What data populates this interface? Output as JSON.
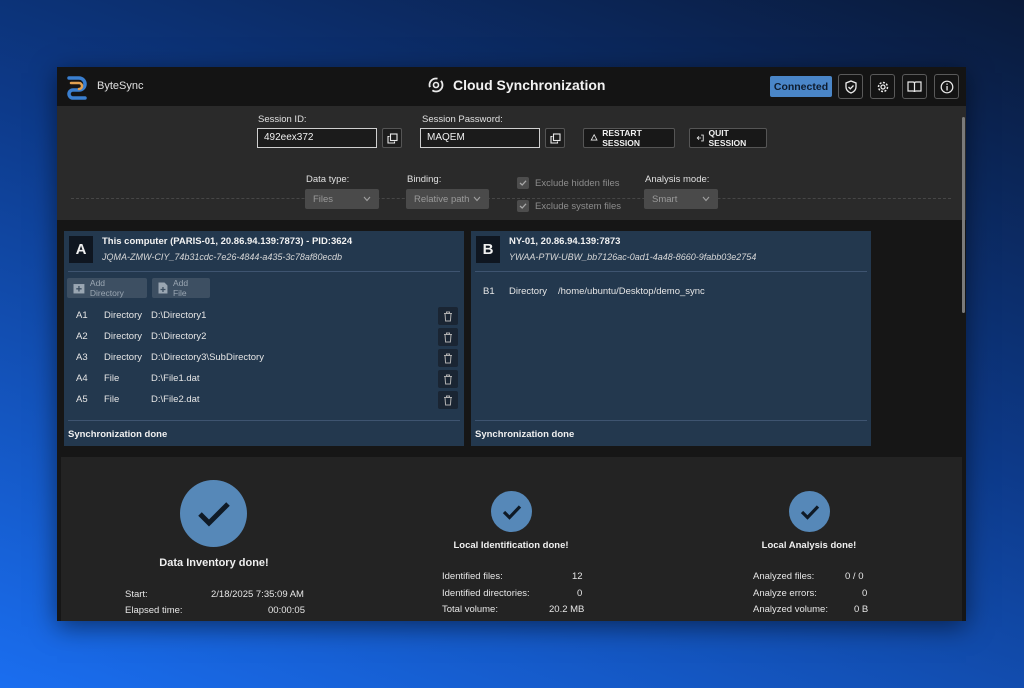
{
  "app": {
    "name": "ByteSync",
    "title": "Cloud Synchronization"
  },
  "header": {
    "status": "Connected",
    "status_color": "#4a86c8"
  },
  "session": {
    "id_label": "Session ID:",
    "id_value": "492eex372",
    "password_label": "Session Password:",
    "password_value": "MAQEM",
    "restart_label": "RESTART SESSION",
    "quit_label": "QUIT SESSION"
  },
  "options": {
    "data_type_label": "Data type:",
    "data_type_value": "Files",
    "binding_label": "Binding:",
    "binding_value": "Relative path",
    "exclude_hidden_label": "Exclude hidden files",
    "exclude_system_label": "Exclude system files",
    "exclude_hidden_checked": true,
    "exclude_system_checked": true,
    "analysis_mode_label": "Analysis mode:",
    "analysis_mode_value": "Smart"
  },
  "panel_a": {
    "letter": "A",
    "name": "This computer (PARIS-01, 20.86.94.139:7873) - PID:3624",
    "id": "JQMA-ZMW-CIY_74b31cdc-7e26-4844-a435-3c78af80ecdb",
    "add_directory_label": "Add Directory",
    "add_file_label": "Add File",
    "rows": [
      {
        "code": "A1",
        "type": "Directory",
        "path": "D:\\Directory1"
      },
      {
        "code": "A2",
        "type": "Directory",
        "path": "D:\\Directory2"
      },
      {
        "code": "A3",
        "type": "Directory",
        "path": "D:\\Directory3\\SubDirectory"
      },
      {
        "code": "A4",
        "type": "File",
        "path": "D:\\File1.dat"
      },
      {
        "code": "A5",
        "type": "File",
        "path": "D:\\File2.dat"
      }
    ],
    "footer": "Synchronization done"
  },
  "panel_b": {
    "letter": "B",
    "name": "NY-01, 20.86.94.139:7873",
    "id": "YWAA-PTW-UBW_bb7126ac-0ad1-4a48-8660-9fabb03e2754",
    "rows": [
      {
        "code": "B1",
        "type": "Directory",
        "path": "/home/ubuntu/Desktop/demo_sync"
      }
    ],
    "footer": "Synchronization done"
  },
  "inventory": {
    "title": "Data Inventory done!",
    "start_label": "Start:",
    "start_value": "2/18/2025 7:35:09 AM",
    "elapsed_label": "Elapsed time:",
    "elapsed_value": "00:00:05"
  },
  "identification": {
    "title": "Local Identification done!",
    "files_label": "Identified files:",
    "files_value": "12",
    "dirs_label": "Identified directories:",
    "dirs_value": "0",
    "volume_label": "Total volume:",
    "volume_value": "20.2 MB"
  },
  "analysis": {
    "title": "Local Analysis done!",
    "files_label": "Analyzed files:",
    "files_value": "0 / 0",
    "errors_label": "Analyze errors:",
    "errors_value": "0",
    "volume_label": "Analyzed volume:",
    "volume_value": "0 B"
  },
  "icons": {
    "logo": "bytesync-logo-icon",
    "title": "cloud-sync-icon",
    "toolbar": [
      "shield-check-icon",
      "gear-icon",
      "book-icon",
      "info-icon"
    ]
  }
}
